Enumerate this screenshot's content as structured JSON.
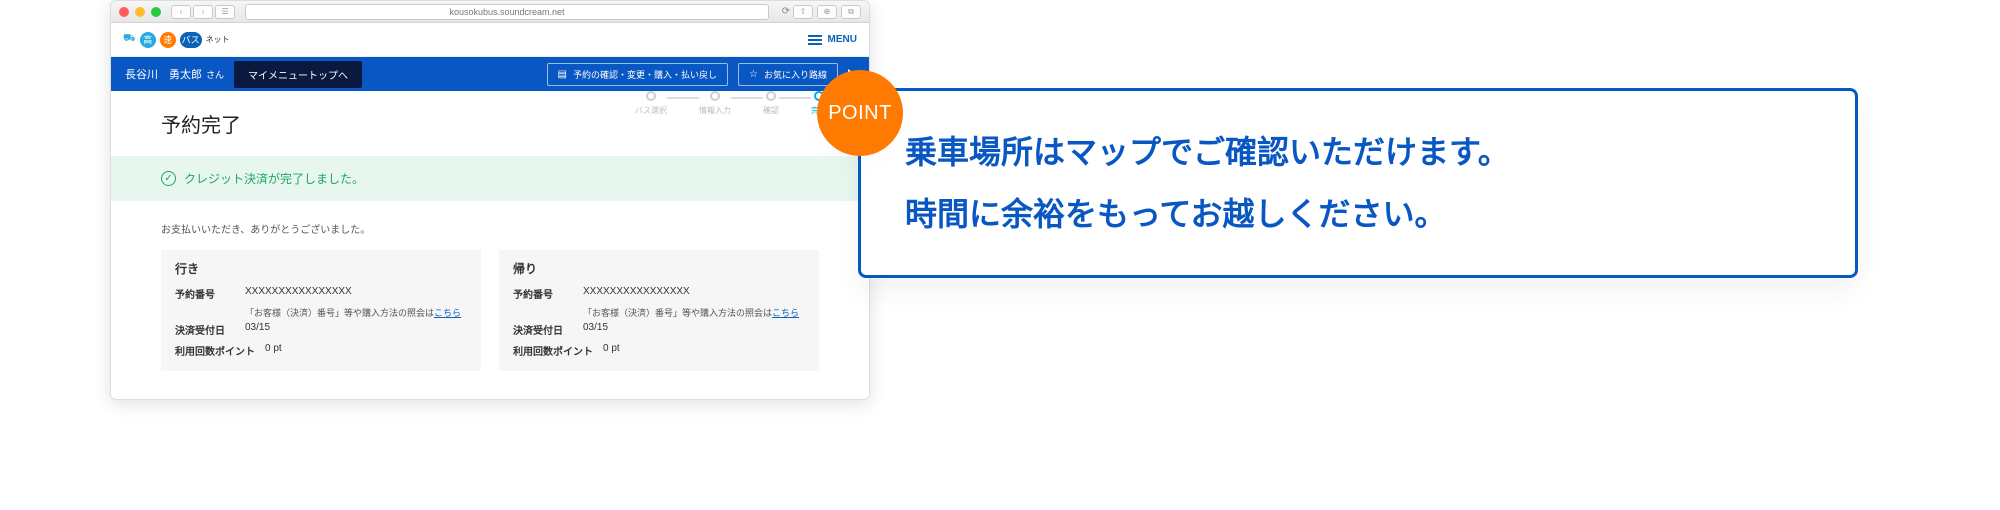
{
  "browser": {
    "url": "kousokubus.soundcream.net"
  },
  "logo": {
    "b1": "高",
    "b2": "速",
    "b3": "バス",
    "sub": "ネット"
  },
  "menu": {
    "label": "MENU"
  },
  "user": {
    "name": "長谷川　勇太郎",
    "suffix": "さん"
  },
  "mymenu_top": "マイメニュートップへ",
  "pill_actions": "予約の確認・変更・購入・払い戻し",
  "pill_fav": "お気に入り路線",
  "page_title": "予約完了",
  "steps": [
    "バス選択",
    "情報入力",
    "確認",
    "完了"
  ],
  "success": "クレジット決済が完了しました。",
  "thanks": "お支払いいただき、ありがとうございました。",
  "outbound": {
    "title": "行き",
    "booking_label": "予約番号",
    "booking_value": "XXXXXXXXXXXXXXXX",
    "note_prefix": "「お客様（決済）番号」等や購入方法の照会は",
    "note_link": "こちら",
    "settle_label": "決済受付日",
    "settle_value": "03/15",
    "points_label": "利用回数ポイント",
    "points_value": "0 pt"
  },
  "inbound": {
    "title": "帰り",
    "booking_label": "予約番号",
    "booking_value": "XXXXXXXXXXXXXXXX",
    "note_prefix": "「お客様（決済）番号」等や購入方法の照会は",
    "note_link": "こちら",
    "settle_label": "決済受付日",
    "settle_value": "03/15",
    "points_label": "利用回数ポイント",
    "points_value": "0 pt"
  },
  "point_badge": "POINT",
  "callout": {
    "line1": "乗車場所はマップでご確認いただけます。",
    "line2": "時間に余裕をもってお越しください。"
  }
}
